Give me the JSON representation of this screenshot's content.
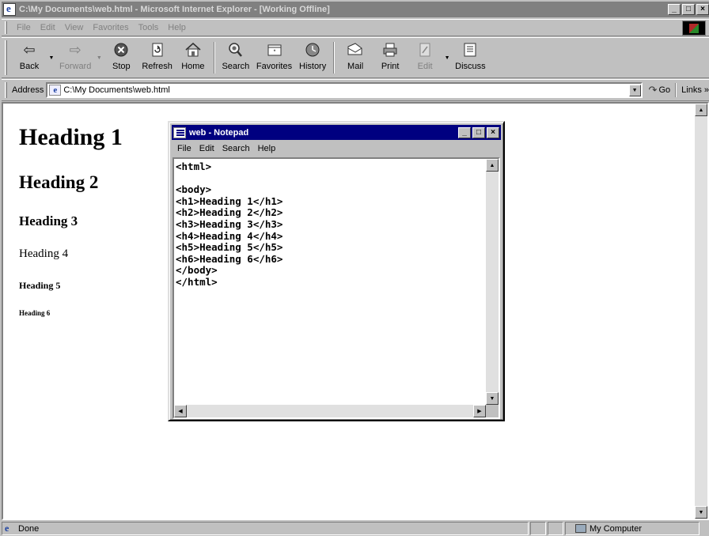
{
  "browser": {
    "title": "C:\\My Documents\\web.html - Microsoft Internet Explorer - [Working Offline]",
    "title_controls": [
      "_",
      "□",
      "×"
    ],
    "menu": [
      "File",
      "Edit",
      "View",
      "Favorites",
      "Tools",
      "Help"
    ],
    "toolbar": [
      {
        "label": "Back",
        "icon": "back-arrow-icon"
      },
      {
        "label": "Forward",
        "icon": "forward-arrow-icon"
      },
      {
        "label": "Stop",
        "icon": "stop-icon"
      },
      {
        "label": "Refresh",
        "icon": "refresh-icon"
      },
      {
        "label": "Home",
        "icon": "home-icon"
      },
      {
        "label": "Search",
        "icon": "search-icon"
      },
      {
        "label": "Favorites",
        "icon": "favorites-icon"
      },
      {
        "label": "History",
        "icon": "history-icon"
      },
      {
        "label": "Mail",
        "icon": "mail-icon"
      },
      {
        "label": "Print",
        "icon": "print-icon"
      },
      {
        "label": "Edit",
        "icon": "edit-icon"
      },
      {
        "label": "Discuss",
        "icon": "discuss-icon"
      }
    ],
    "address": {
      "label": "Address",
      "value": "C:\\My Documents\\web.html",
      "go_label": "Go",
      "links_label": "Links »"
    }
  },
  "page": {
    "h1": "Heading 1",
    "h2": "Heading 2",
    "h3": "Heading 3",
    "h4": "Heading 4",
    "h5": "Heading 5",
    "h6": "Heading 6"
  },
  "notepad": {
    "title": "web - Notepad",
    "menu": [
      "File",
      "Edit",
      "Search",
      "Help"
    ],
    "content": "<html>\n\n<body>\n<h1>Heading 1</h1>\n<h2>Heading 2</h2>\n<h3>Heading 3</h3>\n<h4>Heading 4</h4>\n<h5>Heading 5</h5>\n<h6>Heading 6</h6>\n</body>\n</html>"
  },
  "status": {
    "text": "Done",
    "zone": "My Computer"
  },
  "colors": {
    "inactive_titlebar": "#808080",
    "active_titlebar": "#000080",
    "chrome": "#c0c0c0"
  }
}
